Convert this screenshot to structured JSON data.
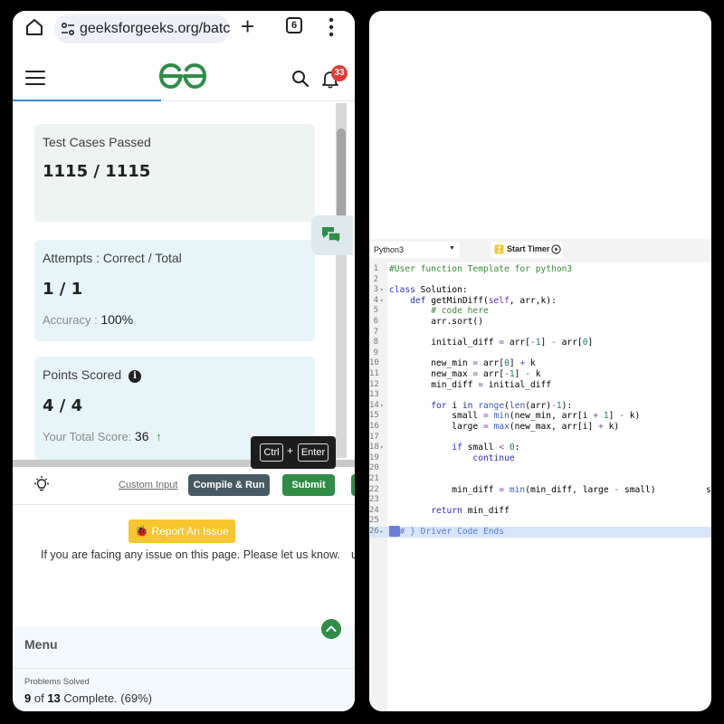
{
  "browser": {
    "url": "geeksforgeeks.org/batc",
    "tab_count": "6"
  },
  "header": {
    "logo": "GG",
    "notification_count": "33"
  },
  "stats": {
    "test_cases_label": "Test Cases Passed",
    "test_cases_value": "1115 / 1115",
    "attempts_label": "Attempts : Correct / Total",
    "attempts_value": "1 / 1",
    "accuracy_label": "Accuracy :",
    "accuracy_value": "100%",
    "points_label": "Points Scored",
    "points_value": "4 / 4",
    "total_score_label": "Your Total Score:",
    "total_score_value": "36"
  },
  "shortcut": {
    "key1": "Ctrl",
    "plus": "+",
    "key2": "Enter"
  },
  "actions": {
    "custom_input": "Custom Input",
    "compile_run": "Compile & Run",
    "submit": "Submit"
  },
  "report": {
    "button": "Report An Issue",
    "message": "If you are facing any issue on this page. Please let us know.",
    "cut_char": "u"
  },
  "menu": {
    "title": "Menu",
    "problems_label": "Problems Solved",
    "solved": "9",
    "of_text": "of",
    "total": "13",
    "complete_text": "Complete. (69%)"
  },
  "editor": {
    "language": "Python3",
    "timer_label": "Start Timer",
    "lines": [
      "#User function Template for python3",
      "",
      "class Solution:",
      "    def getMinDiff(self, arr,k):",
      "        # code here",
      "        arr.sort()",
      "",
      "        initial_diff = arr[-1] - arr[0]",
      "",
      "        new_min = arr[0] + k",
      "        new_max = arr[-1] - k",
      "        min_diff = initial_diff",
      "",
      "        for i in range(len(arr)-1):",
      "            small = min(new_min, arr[i + 1] - k)",
      "            large = max(new_max, arr[i] + k)",
      "",
      "            if small < 0:",
      "                continue",
      "",
      "",
      "            min_diff = min(min_diff, large - small)",
      "",
      "        return min_diff",
      "",
      "# } Driver Code Ends"
    ],
    "line_numbers": [
      "1",
      "2",
      "3",
      "4",
      "5",
      "6",
      "7",
      "8",
      "9",
      "10",
      "11",
      "12",
      "13",
      "14",
      "15",
      "16",
      "17",
      "18",
      "19",
      "20",
      "21",
      "22",
      "23",
      "24",
      "25",
      "26"
    ],
    "edge_char": "s"
  },
  "colors": {
    "brand_green": "#2f8d46",
    "report_yellow": "#f7c52d",
    "compile_gray": "#465a63",
    "badge_red": "#e53935"
  }
}
